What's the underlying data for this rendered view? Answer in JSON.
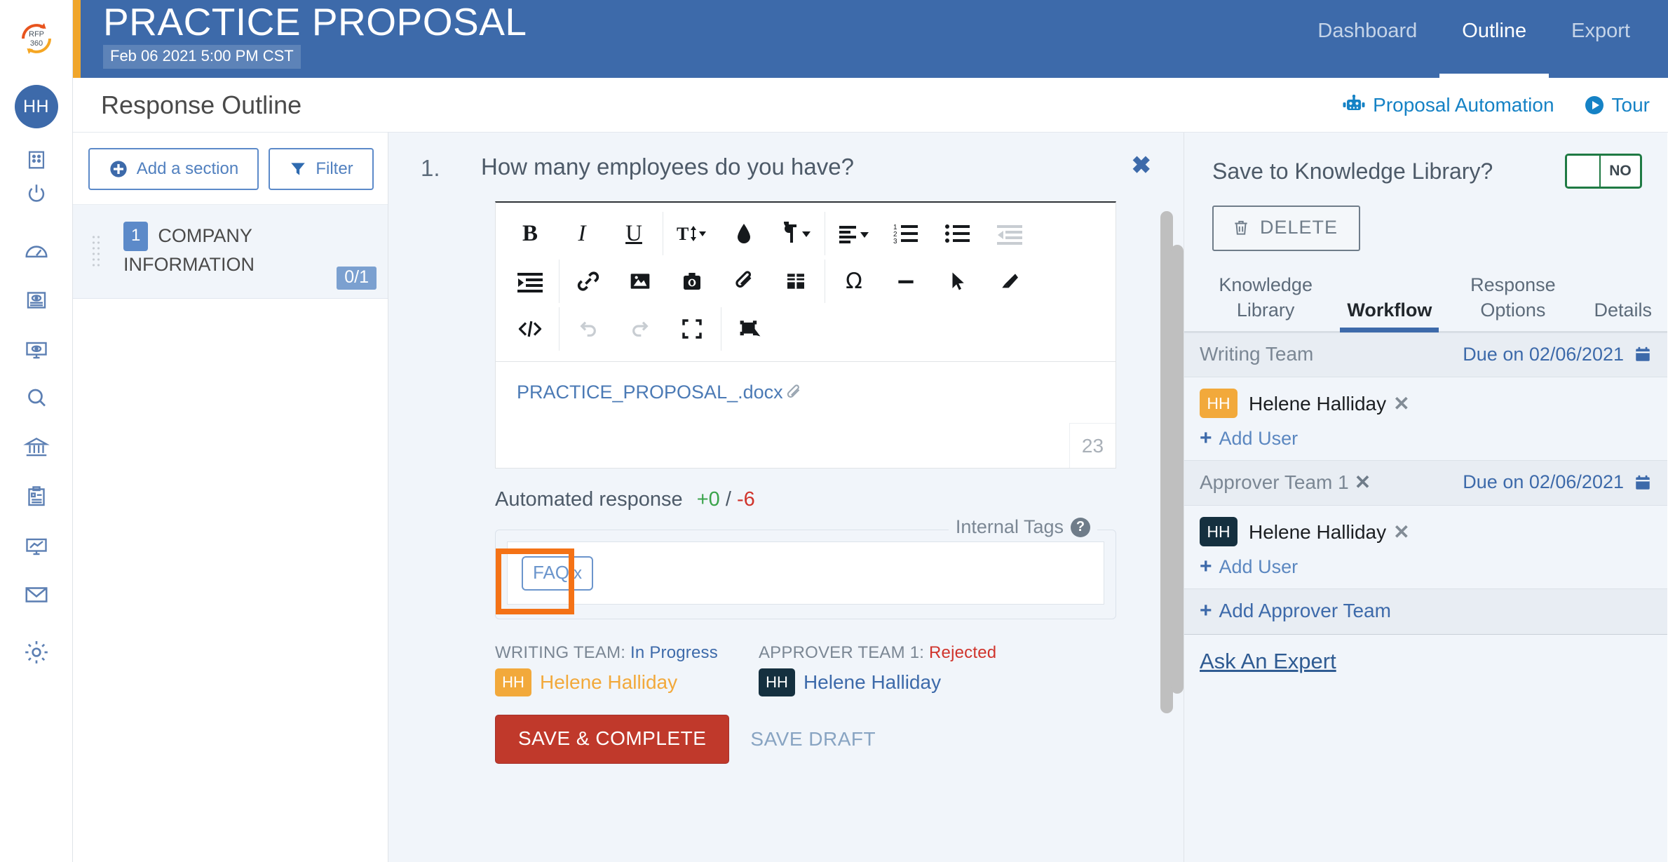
{
  "brand": {
    "logo_text_top": "RFP",
    "logo_text_bottom": "360",
    "accent_orange": "#f0a62b",
    "header_blue": "#3d6aaa",
    "link_blue": "#1582c5"
  },
  "header": {
    "title": "PRACTICE PROPOSAL",
    "date": "Feb 06 2021 5:00 PM CST",
    "nav": [
      {
        "label": "Dashboard",
        "active": false
      },
      {
        "label": "Outline",
        "active": true
      },
      {
        "label": "Export",
        "active": false
      }
    ]
  },
  "subheader": {
    "page_title": "Response Outline",
    "proposal_automation": "Proposal Automation",
    "tour": "Tour"
  },
  "user": {
    "initials": "HH",
    "name": "Helene Halliday"
  },
  "rail": {
    "icons": [
      "building-icon",
      "power-icon",
      "gauge-icon",
      "document-eye-icon",
      "monitor-eye-icon",
      "search-icon",
      "bank-icon",
      "clipboard-icon",
      "chart-monitor-icon",
      "envelope-icon",
      "gear-icon"
    ]
  },
  "outline": {
    "add_section": "Add a section",
    "filter": "Filter",
    "sections": [
      {
        "number": "1",
        "title": "COMPANY INFORMATION",
        "count": "0/1"
      }
    ]
  },
  "question": {
    "number": "1.",
    "text": "How many employees do you have?",
    "close": "✖",
    "toolbar_rows": [
      [
        {
          "name": "bold-icon",
          "label": "B"
        },
        {
          "name": "italic-icon",
          "label": "I"
        },
        {
          "name": "underline-icon",
          "label": "U"
        },
        {
          "name": "font-size-icon",
          "label": ""
        },
        {
          "name": "text-color-icon",
          "label": ""
        },
        {
          "name": "paragraph-format-icon",
          "label": ""
        },
        {
          "name": "align-icon",
          "label": ""
        },
        {
          "name": "ordered-list-icon",
          "label": ""
        },
        {
          "name": "unordered-list-icon",
          "label": ""
        },
        {
          "name": "outdent-icon",
          "label": ""
        }
      ],
      [
        {
          "name": "indent-icon",
          "label": ""
        },
        {
          "name": "link-icon",
          "label": ""
        },
        {
          "name": "image-icon",
          "label": ""
        },
        {
          "name": "camera-icon",
          "label": ""
        },
        {
          "name": "attachment-icon",
          "label": ""
        },
        {
          "name": "table-icon",
          "label": ""
        },
        {
          "name": "special-character-icon",
          "label": "Ω"
        },
        {
          "name": "horizontal-rule-icon",
          "label": ""
        },
        {
          "name": "select-all-icon",
          "label": ""
        },
        {
          "name": "clear-formatting-icon",
          "label": ""
        }
      ],
      [
        {
          "name": "code-view-icon",
          "label": ""
        },
        {
          "name": "undo-icon",
          "label": ""
        },
        {
          "name": "redo-icon",
          "label": ""
        },
        {
          "name": "fullscreen-icon",
          "label": ""
        },
        {
          "name": "insert-object-icon",
          "label": ""
        }
      ]
    ],
    "attachment": "PRACTICE_PROPOSAL_.docx",
    "char_count": "23",
    "automated_response_label": "Automated response",
    "automated_positive": "+0",
    "automated_separator": "/",
    "automated_negative": "-6",
    "internal_tags_label": "Internal Tags",
    "help_glyph": "?",
    "tags": [
      {
        "label": "FAQ",
        "remove": "x"
      }
    ],
    "writing_team_label": "WRITING TEAM:",
    "writing_team_status": "In Progress",
    "writing_team_person": "Helene Halliday",
    "writing_team_initials": "HH",
    "approver_team_label": "APPROVER TEAM 1:",
    "approver_team_status": "Rejected",
    "approver_team_person": "Helene Halliday",
    "approver_team_initials": "HH",
    "save_complete": "SAVE & COMPLETE",
    "save_draft": "SAVE DRAFT"
  },
  "right_panel": {
    "knowledge_library_label": "Save to Knowledge Library?",
    "toggle_value": "NO",
    "delete_label": "DELETE",
    "tabs": [
      {
        "label": "Knowledge Library",
        "active": false
      },
      {
        "label": "Workflow",
        "active": true
      },
      {
        "label": "Response Options",
        "active": false
      },
      {
        "label": "Details",
        "active": false
      }
    ],
    "teams": [
      {
        "name": "Writing Team",
        "removable": false,
        "due": "Due on 02/06/2021",
        "members": [
          {
            "initials": "HH",
            "name": "Helene Halliday",
            "badge": "amber",
            "remove": "✕"
          }
        ],
        "add_user": "Add User"
      },
      {
        "name": "Approver Team 1",
        "removable": true,
        "remove": "✕",
        "due": "Due on 02/06/2021",
        "members": [
          {
            "initials": "HH",
            "name": "Helene Halliday",
            "badge": "navy",
            "remove": "✕"
          }
        ],
        "add_user": "Add User"
      }
    ],
    "add_approver_team": "Add Approver Team",
    "ask_an_expert": "Ask An Expert",
    "plus": "+"
  }
}
